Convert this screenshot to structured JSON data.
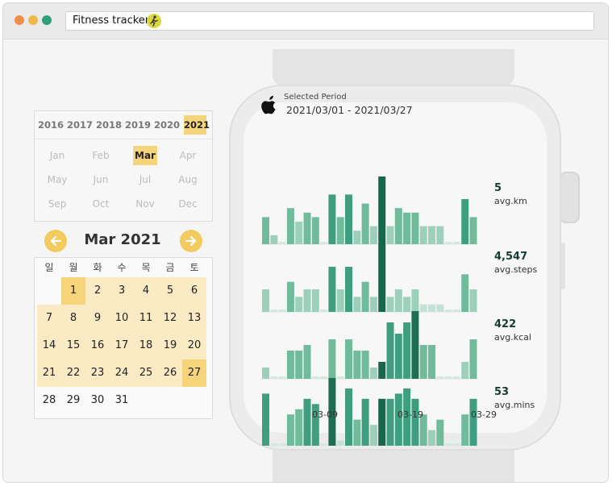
{
  "window": {
    "title": "Fitness tracker",
    "title_icon": "runner-icon",
    "dot_colors": [
      "#ee8e4a",
      "#f0b94e",
      "#2f9f79"
    ]
  },
  "years": {
    "items": [
      "2016",
      "2017",
      "2018",
      "2019",
      "2020",
      "2021"
    ],
    "selected": "2021"
  },
  "months": {
    "items": [
      "Jan",
      "Feb",
      "Mar",
      "Apr",
      "May",
      "Jun",
      "Jul",
      "Aug",
      "Sep",
      "Oct",
      "Nov",
      "Dec"
    ],
    "selected": "Mar"
  },
  "calendar": {
    "title": "Mar 2021",
    "prev_icon": "arrow-left-icon",
    "next_icon": "arrow-right-icon",
    "weekdays": [
      "일",
      "월",
      "화",
      "수",
      "목",
      "금",
      "토"
    ],
    "days": [
      "1",
      "2",
      "3",
      "4",
      "5",
      "6",
      "7",
      "8",
      "9",
      "10",
      "11",
      "12",
      "13",
      "14",
      "15",
      "16",
      "17",
      "18",
      "19",
      "20",
      "21",
      "22",
      "23",
      "24",
      "25",
      "26",
      "27",
      "28",
      "29",
      "30",
      "31"
    ],
    "range_start": "1",
    "range_end": "27",
    "highlight_color": "#f6d47c",
    "band_color": "#fbebc4"
  },
  "watch": {
    "logo_icon": "apple-icon",
    "period_label": "Selected Period",
    "period_range": "2021/03/01 - 2021/03/27",
    "x_ticks": [
      "03-09",
      "03-19",
      "03-29"
    ]
  },
  "chart_data": [
    {
      "type": "bar",
      "x": [
        "03-01",
        "03-02",
        "03-03",
        "03-04",
        "03-05",
        "03-06",
        "03-07",
        "03-08",
        "03-09",
        "03-10",
        "03-11",
        "03-12",
        "03-13",
        "03-14",
        "03-15",
        "03-16",
        "03-17",
        "03-18",
        "03-19",
        "03-20",
        "03-21",
        "03-22",
        "03-23",
        "03-24",
        "03-25",
        "03-26",
        "03-27",
        "03-28",
        "03-29"
      ],
      "values": [
        6,
        2,
        0,
        8,
        5,
        7,
        6,
        0,
        11,
        6,
        11,
        3,
        9,
        4,
        15,
        4,
        8,
        7,
        7,
        4,
        4,
        4,
        0,
        0,
        10,
        6,
        null,
        null,
        null
      ],
      "summary_value": "5",
      "summary_label": "avg.km"
    },
    {
      "type": "bar",
      "x": [
        "03-01",
        "03-02",
        "03-03",
        "03-04",
        "03-05",
        "03-06",
        "03-07",
        "03-08",
        "03-09",
        "03-10",
        "03-11",
        "03-12",
        "03-13",
        "03-14",
        "03-15",
        "03-16",
        "03-17",
        "03-18",
        "03-19",
        "03-20",
        "03-21",
        "03-22",
        "03-23",
        "03-24",
        "03-25",
        "03-26",
        "03-27",
        "03-28",
        "03-29"
      ],
      "values": [
        3,
        0,
        0,
        4,
        2,
        3,
        3,
        0,
        6,
        3,
        6,
        2,
        4,
        2,
        9,
        2,
        3,
        2,
        3,
        1,
        1,
        1,
        0,
        0,
        5,
        3,
        null,
        null,
        null
      ],
      "summary_value": "4,547",
      "summary_label": "avg.steps"
    },
    {
      "type": "bar",
      "x": [
        "03-01",
        "03-02",
        "03-03",
        "03-04",
        "03-05",
        "03-06",
        "03-07",
        "03-08",
        "03-09",
        "03-10",
        "03-11",
        "03-12",
        "03-13",
        "03-14",
        "03-15",
        "03-16",
        "03-17",
        "03-18",
        "03-19",
        "03-20",
        "03-21",
        "03-22",
        "03-23",
        "03-24",
        "03-25",
        "03-26",
        "03-27",
        "03-28",
        "03-29"
      ],
      "values": [
        2,
        0,
        0,
        5,
        5,
        6,
        0,
        0,
        7,
        0,
        7,
        5,
        5,
        2,
        3,
        10,
        8,
        10,
        12,
        6,
        6,
        0,
        0,
        0,
        3,
        7,
        null,
        null,
        null
      ],
      "summary_value": "422",
      "summary_label": "avg.kcal"
    },
    {
      "type": "bar",
      "x": [
        "03-01",
        "03-02",
        "03-03",
        "03-04",
        "03-05",
        "03-06",
        "03-07",
        "03-08",
        "03-09",
        "03-10",
        "03-11",
        "03-12",
        "03-13",
        "03-14",
        "03-15",
        "03-16",
        "03-17",
        "03-18",
        "03-19",
        "03-20",
        "03-21",
        "03-22",
        "03-23",
        "03-24",
        "03-25",
        "03-26",
        "03-27",
        "03-28",
        "03-29"
      ],
      "values": [
        10,
        0,
        0,
        6,
        7,
        9,
        8,
        0,
        13,
        1,
        11,
        5,
        9,
        4,
        9,
        9,
        10,
        11,
        9,
        6,
        3,
        5,
        0,
        0,
        6,
        9,
        null,
        null,
        null
      ],
      "summary_value": "53",
      "summary_label": "avg.mins"
    }
  ]
}
